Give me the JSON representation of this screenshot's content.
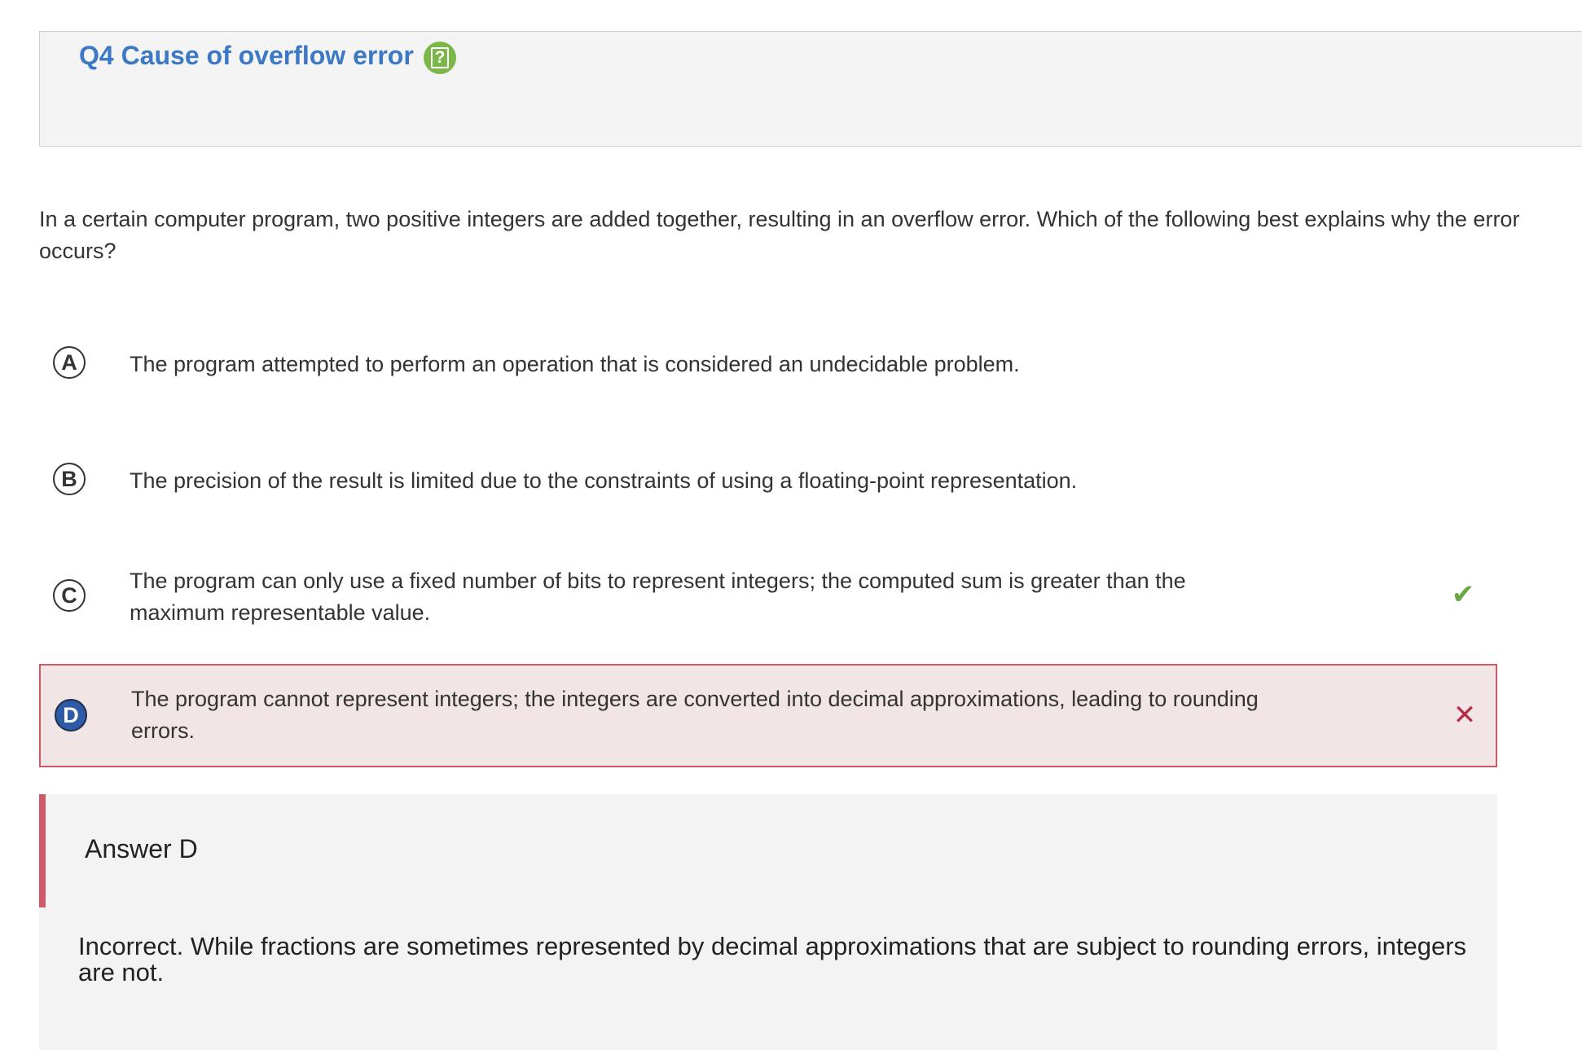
{
  "question": {
    "title": "Q4 Cause of overflow error",
    "help_icon": "question-mark-icon",
    "prompt": "In a certain computer program, two positive integers are added together, resulting in an overflow error. Which of the following best explains why the error occurs?"
  },
  "options": [
    {
      "letter": "A",
      "text": "The program attempted to perform an operation that is considered an undecidable problem.",
      "state": "unselected"
    },
    {
      "letter": "B",
      "text": "The precision of the result is limited due to the constraints of using a floating-point representation.",
      "state": "unselected"
    },
    {
      "letter": "C",
      "text": "The program can only use a fixed number of bits to represent integers; the computed sum is greater than the maximum representable value.",
      "state": "correct",
      "icon": "checkmark-icon"
    },
    {
      "letter": "D",
      "text": "The program cannot represent integers; the integers are converted into decimal approximations, leading to rounding errors.",
      "state": "selected-incorrect",
      "icon": "cross-icon"
    }
  ],
  "feedback": {
    "heading": "Answer D",
    "text": "Incorrect. While fractions are sometimes represented by decimal approximations that are subject to rounding errors, integers are not."
  },
  "colors": {
    "title": "#3b78c5",
    "help_icon": "#7ab648",
    "correct": "#6aa843",
    "incorrect": "#b52e48",
    "incorrect_bg": "#f1e5e6",
    "selected_letter": "#2e5ba8"
  }
}
